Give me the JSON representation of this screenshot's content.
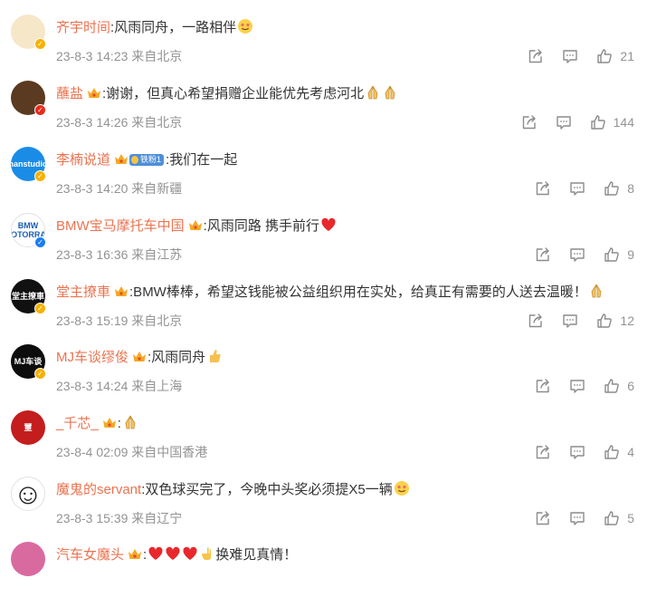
{
  "comments": [
    {
      "user": "齐宇时间",
      "crown": false,
      "fan_badge": "",
      "text": ":风雨同舟，一路相伴",
      "emojis": [
        "smile-face"
      ],
      "meta": "23-8-3 14:23 来自北京",
      "likes": "21",
      "avatar_color": "#f6e7c9",
      "verified_color": "#f6b100"
    },
    {
      "user": "蘸盐",
      "crown": true,
      "fan_badge": "",
      "text": ":谢谢，但真心希望捐赠企业能优先考虑河北",
      "emojis": [
        "pray",
        "pray"
      ],
      "meta": "23-8-3 14:26 来自北京",
      "likes": "144",
      "avatar_color": "#5a3a20",
      "verified_color": "#e8291c"
    },
    {
      "user": "李楠说道",
      "crown": true,
      "fan_badge": "铁粉1",
      "text": ":我们在一起",
      "emojis": [],
      "meta": "23-8-3 14:20 来自新疆",
      "likes": "8",
      "avatar_color": "#1b8ce6",
      "avatar_text": "nanstudio",
      "verified_color": "#f6b100"
    },
    {
      "user": "BMW宝马摩托车中国",
      "crown": true,
      "fan_badge": "",
      "text": ":风雨同路 携手前行",
      "emojis": [
        "heart"
      ],
      "meta": "23-8-3 16:36 来自江苏",
      "likes": "9",
      "avatar_color": "#ffffff",
      "avatar_text": "BMW MOTORRAD",
      "verified_color": "#1a7ef0"
    },
    {
      "user": "堂主撩車",
      "crown": true,
      "fan_badge": "",
      "text": ":BMW棒棒，希望这钱能被公益组织用在实处，给真正有需要的人送去温暖！",
      "emojis": [
        "pray"
      ],
      "meta": "23-8-3 15:19 来自北京",
      "likes": "12",
      "avatar_color": "#111111",
      "avatar_text": "堂主撩車",
      "verified_color": "#f6b100"
    },
    {
      "user": "MJ车谈缪俊",
      "crown": true,
      "fan_badge": "",
      "text": ":风雨同舟",
      "emojis": [
        "thumb"
      ],
      "meta": "23-8-3 14:24 来自上海",
      "likes": "6",
      "avatar_color": "#0d0d0d",
      "avatar_text": "MJ车谈",
      "verified_color": "#f6b100"
    },
    {
      "user": "_千芯_",
      "crown": true,
      "fan_badge": "",
      "text": ":",
      "emojis": [
        "pray"
      ],
      "meta": "23-8-4 02:09 来自中国香港",
      "likes": "4",
      "avatar_color": "#c41d1d",
      "avatar_text": "壐",
      "verified_color": ""
    },
    {
      "user": "魔鬼的servant",
      "crown": false,
      "fan_badge": "",
      "text": ":双色球买完了，今晚中头奖必须提X5一辆",
      "emojis": [
        "smile-face"
      ],
      "meta": "23-8-3 15:39 来自辽宁",
      "likes": "5",
      "avatar_color": "#ffffff",
      "avatar_text": "☺",
      "verified_color": ""
    },
    {
      "user": "汽车女魔头",
      "crown": true,
      "fan_badge": "",
      "text": ":",
      "emojis": [
        "heart",
        "heart",
        "heart",
        "hand"
      ],
      "text_after": "换难见真情！",
      "meta": "",
      "likes": "",
      "avatar_color": "#d96aa0",
      "verified_color": ""
    }
  ]
}
